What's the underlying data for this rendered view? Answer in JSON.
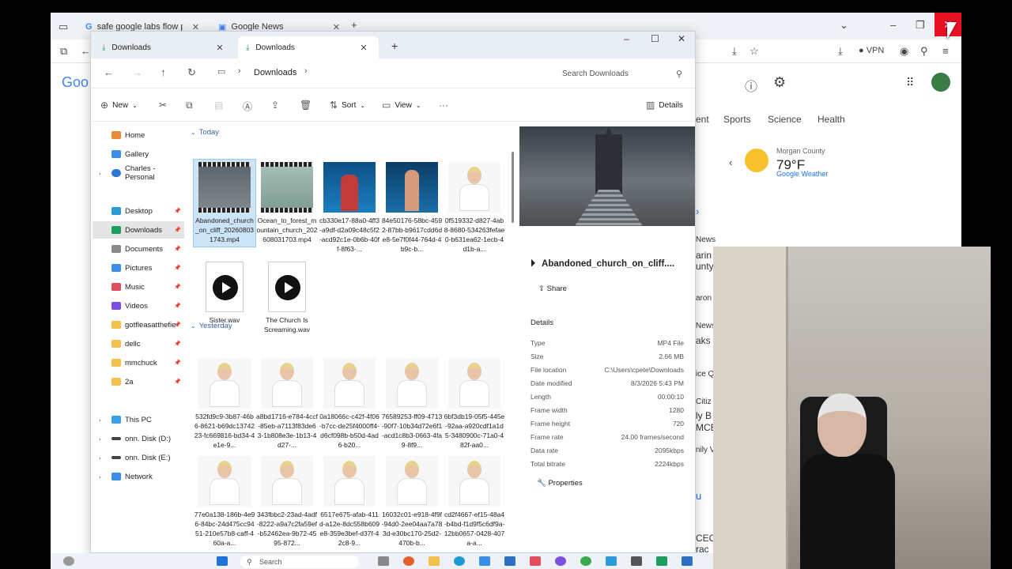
{
  "browser": {
    "tabs": [
      {
        "label": "safe google labs flow prompt w"
      },
      {
        "label": "Google News"
      }
    ],
    "logo": "Goo",
    "vpn": "VPN",
    "nav": [
      "ent",
      "Sports",
      "Science",
      "Health"
    ],
    "weather": {
      "location": "Morgan County",
      "temp": "79°F",
      "link": "Google Weather"
    },
    "side_snippets": [
      "News",
      "arin",
      "unty",
      "aron",
      "News",
      "aks",
      "ice Q",
      "Citiz",
      "ly B",
      "MCE",
      "nily V",
      "u",
      "CEO",
      "rac"
    ]
  },
  "explorer": {
    "tabs": [
      {
        "label": "Downloads"
      },
      {
        "label": "Downloads"
      }
    ],
    "path": [
      "Downloads"
    ],
    "search_placeholder": "Search Downloads",
    "commands": {
      "new": "New",
      "sort": "Sort",
      "view": "View",
      "details": "Details"
    },
    "nav": [
      {
        "label": "Home",
        "color": "#e58b3a"
      },
      {
        "label": "Gallery",
        "color": "#3a8ee5"
      },
      {
        "label": "Charles - Personal",
        "color": "#2b78d6"
      },
      {
        "label": "Desktop",
        "color": "#2b9ad6",
        "pin": true
      },
      {
        "label": "Downloads",
        "color": "#1e9c5c",
        "pin": true
      },
      {
        "label": "Documents",
        "color": "#8a8a8a",
        "pin": true
      },
      {
        "label": "Pictures",
        "color": "#3a8ee5",
        "pin": true
      },
      {
        "label": "Music",
        "color": "#e04f5f",
        "pin": true
      },
      {
        "label": "Videos",
        "color": "#7b4fe0",
        "pin": true
      },
      {
        "label": "gotfleasatthefie",
        "color": "#f2c14e",
        "pin": true
      },
      {
        "label": "dellc",
        "color": "#f2c14e",
        "pin": true
      },
      {
        "label": "mmchuck",
        "color": "#f2c14e",
        "pin": true
      },
      {
        "label": "2a",
        "color": "#f2c14e",
        "pin": true
      },
      {
        "label": "This PC",
        "color": "#3aa0e5"
      },
      {
        "label": "onn. Disk (D:)",
        "color": "#444444"
      },
      {
        "label": "onn. Disk (E:)",
        "color": "#444444"
      },
      {
        "label": "Network",
        "color": "#3a8ee5"
      }
    ],
    "groups": {
      "today": "Today",
      "yesterday": "Yesterday"
    },
    "today_files": [
      {
        "name": "Abandoned_church_on_cliff_202608031743.mp4",
        "kind": "video"
      },
      {
        "name": "Ocean_to_forest_mountain_church_202608031703.mp4",
        "kind": "video"
      },
      {
        "name": "cb330e17-88a0-4ff3-a9df-d2a09c48c5f2-acd92c1e-0b6b-40ff-8f63-...",
        "kind": "aquarium"
      },
      {
        "name": "84e50176-58bc-4592-87bb-b9617cdd6de8-5e7f0f44-764d-4b9c-b...",
        "kind": "aquarium"
      },
      {
        "name": "0f519332-d827-4ab8-8680-534263fefae0-b631ea62-1ecb-4d1b-a...",
        "kind": "face"
      },
      {
        "name": "Sister.wav",
        "kind": "wav"
      },
      {
        "name": "The Church Is Screaming.wav",
        "kind": "wav"
      }
    ],
    "yesterday_files": [
      {
        "name": "532fd9c9-3b87-46b6-8621-b69dc1374223-fc669816-bd34-4e1e-9..."
      },
      {
        "name": "a8bd1716-e784-4ccf-85eb-a7113f83de63-1b808e3e-1b13-4d27-..."
      },
      {
        "name": "0a18066c-c42f-4f06-b7cc-de25f4000ff4-d6cf098b-b50d-4ad6-b20..."
      },
      {
        "name": "76589253-ff09-4713-90f7-10b34d72e6f1-acd1c8b3-0663-4fa9-8f9..."
      },
      {
        "name": "6bf3db19-05f5-445e-92aa-a920cdf1a1d5-3480900c-71a0-482f-aa0..."
      },
      {
        "name": "77e0a138-186b-4e96-84bc-24d475cc9451-210e57b8-caff-460a-a..."
      },
      {
        "name": "343fbbc2-23ad-4adf-8222-a9a7c2fa59ef-b52462ea-9b72-4595-872..."
      },
      {
        "name": "6517e675-afab-411d-a12e-8dc558b609e8-359e3bef-d37f-42c8-9..."
      },
      {
        "name": "16032c01-e918-4f9f-94d0-2ee04aa7a783d-e30bc170-25d2-470b-b..."
      },
      {
        "name": "cd2f4667-ef15-48a4-b4bd-f1d9f5c6df9a-12bb0657-0428-407a-a..."
      }
    ],
    "details": {
      "title": "Abandoned_church_on_cliff....",
      "share": "Share",
      "header": "Details",
      "properties": [
        {
          "k": "Type",
          "v": "MP4 File"
        },
        {
          "k": "Size",
          "v": "2.66 MB"
        },
        {
          "k": "File location",
          "v": "C:\\Users\\cpete\\Downloads"
        },
        {
          "k": "Date modified",
          "v": "8/3/2026 5:43 PM"
        },
        {
          "k": "Length",
          "v": "00:00:10"
        },
        {
          "k": "Frame width",
          "v": "1280"
        },
        {
          "k": "Frame height",
          "v": "720"
        },
        {
          "k": "Frame rate",
          "v": "24.00 frames/second"
        },
        {
          "k": "Data rate",
          "v": "2095kbps"
        },
        {
          "k": "Total bitrate",
          "v": "2224kbps"
        }
      ],
      "properties_link": "Properties"
    }
  },
  "taskbar": {
    "search": "Search"
  }
}
